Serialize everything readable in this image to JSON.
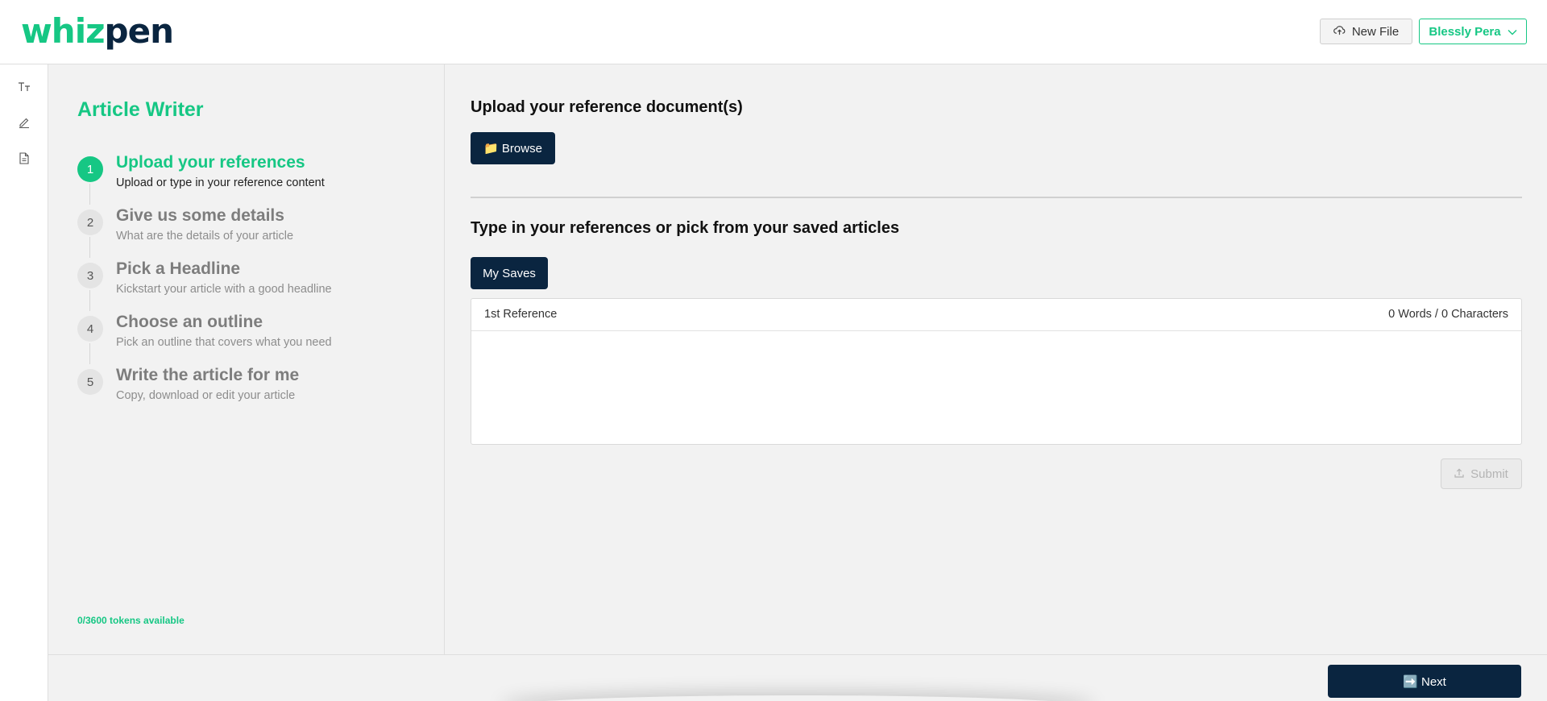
{
  "header": {
    "logo_part1": "whiz",
    "logo_part2": "pen",
    "new_file_label": "New File",
    "user_name": "Blessly Pera"
  },
  "rail": {
    "icons": [
      "text-size-icon",
      "pencil-icon",
      "document-icon"
    ]
  },
  "steps_panel": {
    "title": "Article Writer",
    "steps": [
      {
        "number": "1",
        "title": "Upload your references",
        "subtitle": "Upload or type in your reference content",
        "active": true
      },
      {
        "number": "2",
        "title": "Give us some details",
        "subtitle": "What are the details of your article",
        "active": false
      },
      {
        "number": "3",
        "title": "Pick a Headline",
        "subtitle": "Kickstart your article with a good headline",
        "active": false
      },
      {
        "number": "4",
        "title": "Choose an outline",
        "subtitle": "Pick an outline that covers what you need",
        "active": false
      },
      {
        "number": "5",
        "title": "Write the article for me",
        "subtitle": "Copy, download or edit your article",
        "active": false
      }
    ],
    "tokens": "0/3600 tokens available"
  },
  "main": {
    "upload_heading": "Upload your reference document(s)",
    "browse_label": "📁 Browse",
    "type_heading": "Type in your references or pick from your saved articles",
    "my_saves_label": "My Saves",
    "reference_label": "1st Reference",
    "reference_count": "0 Words / 0 Characters",
    "reference_value": "",
    "submit_label": "Submit"
  },
  "footer": {
    "next_label": "➡️ Next"
  },
  "colors": {
    "brand_green": "#16c784",
    "navy": "#0a2540"
  }
}
